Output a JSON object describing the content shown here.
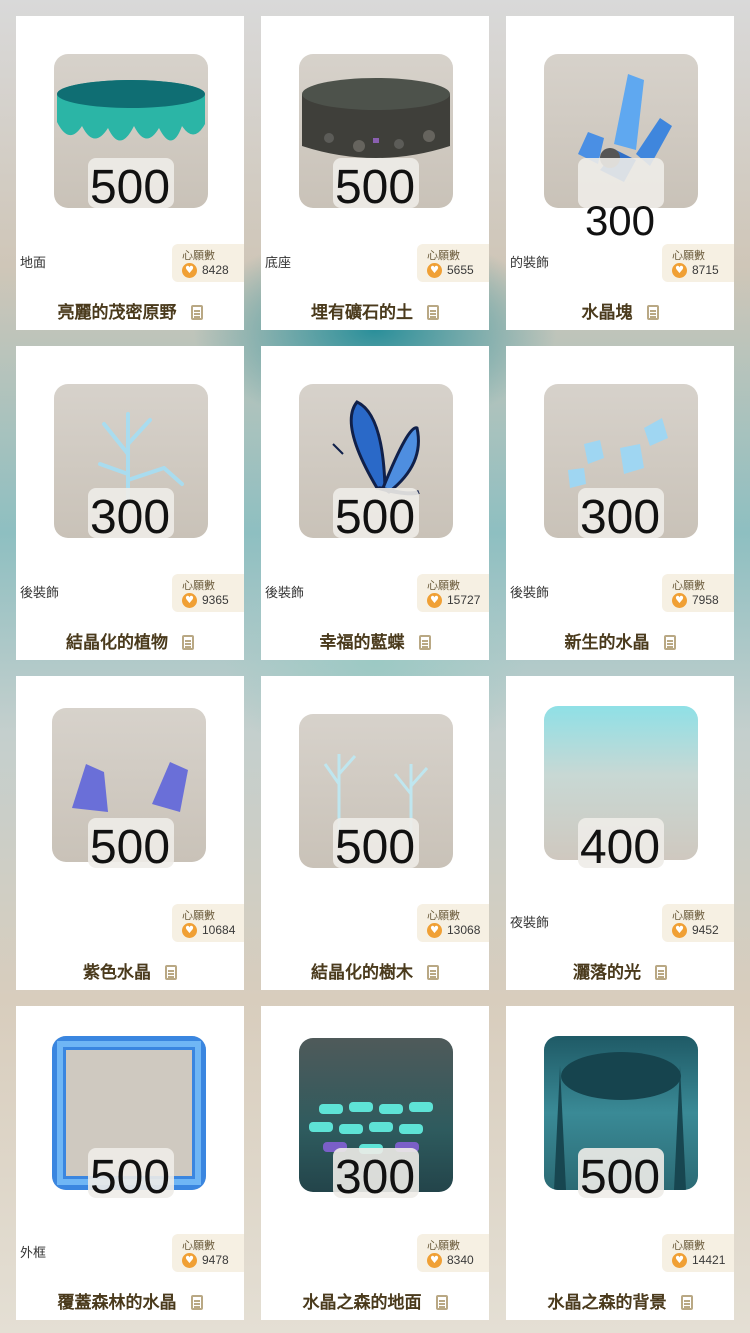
{
  "wish_label": "心願數",
  "items": [
    {
      "price": "500",
      "category": "地面",
      "wishes": "8428",
      "name": "亮麗的茂密原野",
      "icon": "meadow-ground-icon"
    },
    {
      "price": "500",
      "category": "底座",
      "wishes": "5655",
      "name": "埋有礦石的土",
      "icon": "ore-soil-icon"
    },
    {
      "price": "300",
      "category": "的裝飾",
      "wishes": "8715",
      "name": "水晶塊",
      "icon": "crystal-cluster-icon"
    },
    {
      "price": "300",
      "category": "後裝飾",
      "wishes": "9365",
      "name": "結晶化的植物",
      "icon": "crystal-plant-icon"
    },
    {
      "price": "500",
      "category": "後裝飾",
      "wishes": "15727",
      "name": "幸福的藍蝶",
      "icon": "blue-butterfly-icon"
    },
    {
      "price": "300",
      "category": "後裝飾",
      "wishes": "7958",
      "name": "新生的水晶",
      "icon": "new-crystal-icon"
    },
    {
      "price": "500",
      "category": "",
      "wishes": "10684",
      "name": "紫色水晶",
      "icon": "purple-crystal-icon"
    },
    {
      "price": "500",
      "category": "",
      "wishes": "13068",
      "name": "結晶化的樹木",
      "icon": "crystal-tree-icon"
    },
    {
      "price": "400",
      "category": "夜裝飾",
      "wishes": "9452",
      "name": "灑落的光",
      "icon": "light-rays-icon"
    },
    {
      "price": "500",
      "category": "外框",
      "wishes": "9478",
      "name": "覆蓋森林的水晶",
      "icon": "crystal-frame-icon"
    },
    {
      "price": "300",
      "category": "",
      "wishes": "8340",
      "name": "水晶之森的地面",
      "icon": "crystal-floor-icon"
    },
    {
      "price": "500",
      "category": "",
      "wishes": "14421",
      "name": "水晶之森的背景",
      "icon": "crystal-forest-bg-icon"
    }
  ]
}
